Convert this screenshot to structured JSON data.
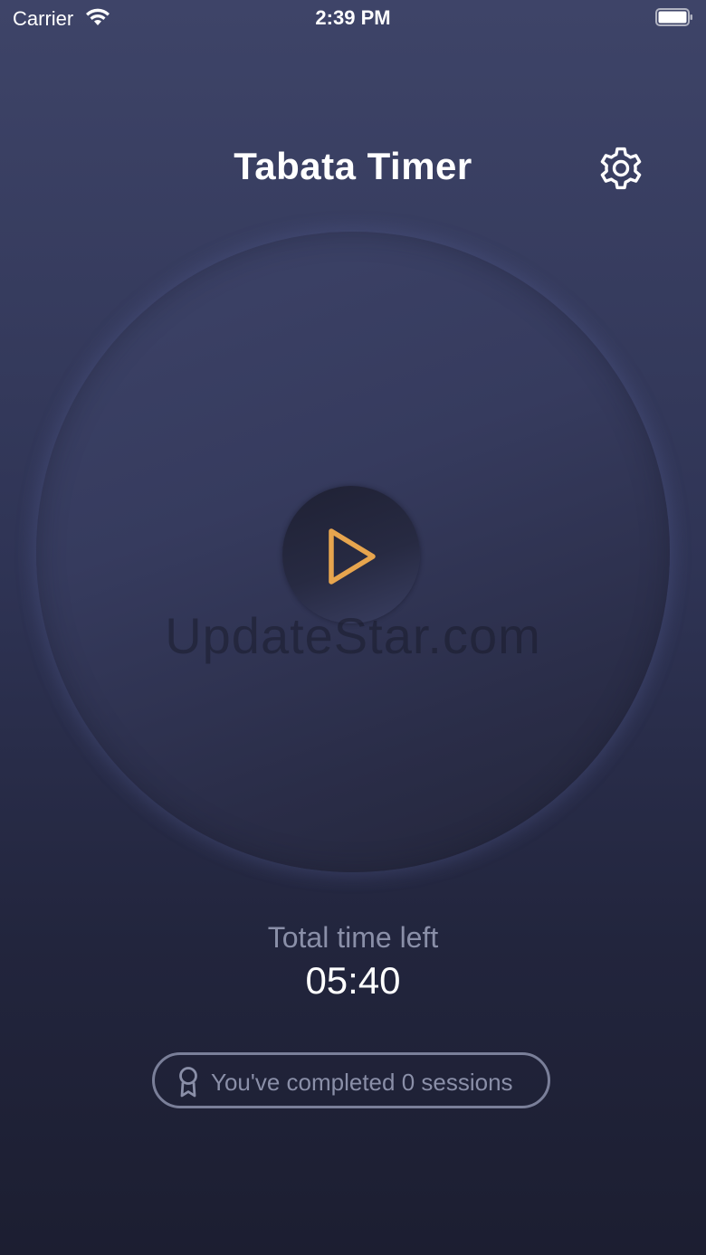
{
  "status_bar": {
    "carrier": "Carrier",
    "time": "2:39 PM"
  },
  "header": {
    "title": "Tabata Timer",
    "settings_icon": "gear-icon"
  },
  "timer": {
    "play_icon": "play-icon",
    "watermark": "UpdateStar.com",
    "total_label": "Total time left",
    "total_value": "05:40"
  },
  "sessions": {
    "icon": "award-ribbon-icon",
    "text": "You've completed 0 sessions"
  },
  "colors": {
    "accent": "#e7a54e",
    "background_top": "#3e4468",
    "background_bottom": "#1c1e31",
    "muted_text": "#8a8fa8"
  }
}
